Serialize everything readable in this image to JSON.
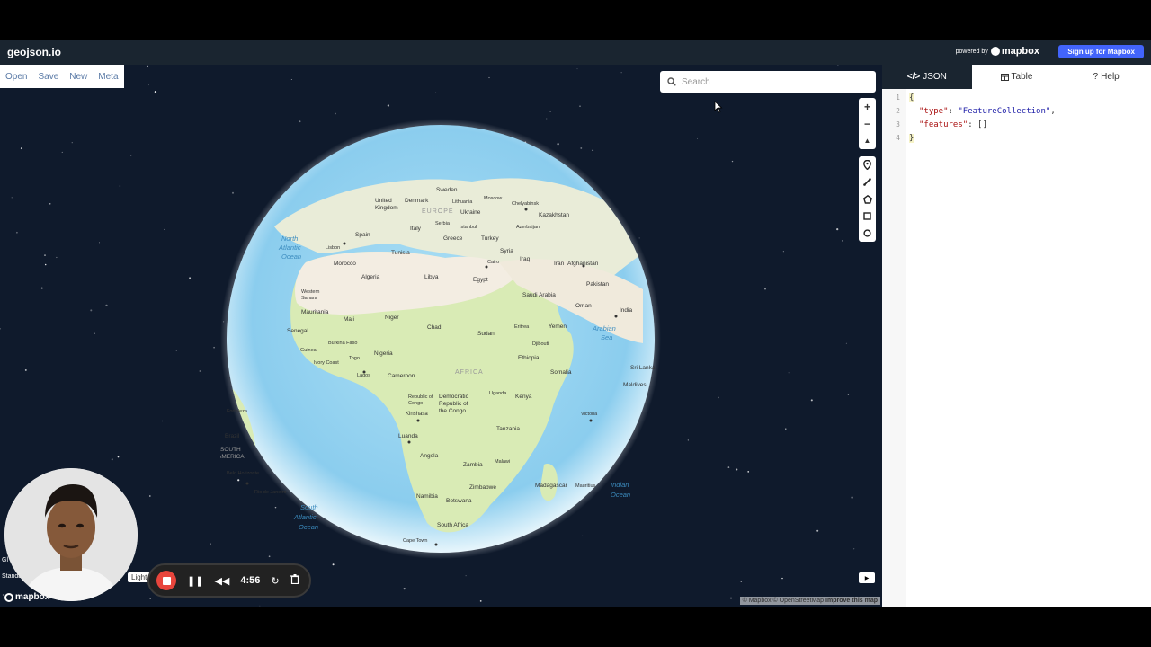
{
  "app": {
    "title": "geojson.io"
  },
  "header": {
    "powered_by": "powered by",
    "mapbox_brand": "mapbox",
    "signup_label": "Sign up for Mapbox"
  },
  "file_menu": {
    "open": "Open",
    "save": "Save",
    "new": "New",
    "meta": "Meta"
  },
  "search": {
    "placeholder": "Search"
  },
  "map_controls": {
    "zoom_in": "+",
    "zoom_out": "−",
    "compass": "▲"
  },
  "draw_tools": [
    "marker-tool",
    "line-tool",
    "polygon-tool",
    "rectangle-tool",
    "circle-tool"
  ],
  "globe_labels": {
    "countries": [
      "Sweden",
      "United Kingdom",
      "Denmark",
      "Lithuania",
      "Moscow",
      "Chelyabinsk",
      "Ukraine",
      "EUROPE",
      "Serbia",
      "Spain",
      "Italy",
      "Istanbul",
      "Kazakhstan",
      "Azerbaijan",
      "Lisbon",
      "Greece",
      "Turkey",
      "Tunisia",
      "Syria",
      "Iraq",
      "Morocco",
      "Cairo",
      "Iran",
      "Afghanistan",
      "Algeria",
      "Libya",
      "Egypt",
      "Pakistan",
      "Western Sahara",
      "Saudi Arabia",
      "Oman",
      "India",
      "Mauritania",
      "Mali",
      "Niger",
      "Chad",
      "Sudan",
      "Eritrea",
      "Yemen",
      "Senegal",
      "Burkina Faso",
      "Guinea",
      "Djibouti",
      "Ivory Coast",
      "Togo",
      "Nigeria",
      "Ethiopia",
      "Lagos",
      "Cameroon",
      "AFRICA",
      "Somalia",
      "Sri Lanka",
      "Maldives",
      "Republic of Congo",
      "Democratic Republic of the Congo",
      "Uganda",
      "Kenya",
      "Kinshasa",
      "Fortaleza",
      "Victoria",
      "Brazil",
      "Luanda",
      "Tanzania",
      "SOUTH AMERICA",
      "Angola",
      "Malawi",
      "Belo Horizonte",
      "Zambia",
      "Rio de Janeiro",
      "Zimbabwe",
      "Madagascar",
      "Mauritius",
      "Namibia",
      "Botswana",
      "South Africa",
      "Cape Town",
      "ANTARCTICA"
    ],
    "oceans": [
      "North Atlantic Ocean",
      "Arabian Sea",
      "South Atlantic Ocean",
      "Indian Ocean"
    ]
  },
  "map_footer": {
    "attribution": "© Mapbox © OpenStreetMap",
    "improve": "Improve this map",
    "style_light": "Light",
    "style_fragment": "Standa",
    "mapbox_logo": "mapbox"
  },
  "recorder": {
    "time": "4:56"
  },
  "panel": {
    "tabs": [
      {
        "label": "JSON",
        "active": true
      },
      {
        "label": "Table",
        "active": false
      },
      {
        "label": "Help",
        "active": false
      }
    ],
    "code_lines": [
      {
        "n": "1",
        "text": "{"
      },
      {
        "n": "2",
        "key": "\"type\"",
        "value": "\"FeatureCollection\"",
        "suffix": ","
      },
      {
        "n": "3",
        "key": "\"features\"",
        "value": "[]",
        "suffix": ""
      },
      {
        "n": "4",
        "text": "}"
      }
    ]
  },
  "colors": {
    "header_bg": "#1a2530",
    "map_bg": "#0f1a2c",
    "accent": "#4264fb",
    "ocean": "#8fd0ef",
    "land": "#cfe6a8"
  }
}
